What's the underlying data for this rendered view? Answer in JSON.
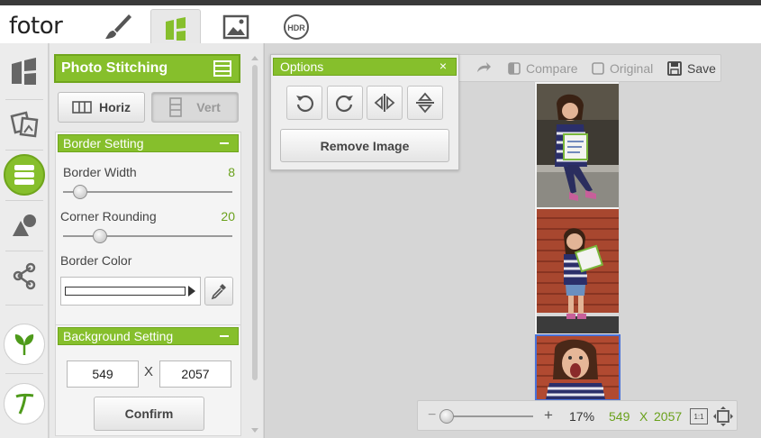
{
  "app": {
    "logo": "fotor"
  },
  "topbar": {
    "tools": [
      {
        "name": "edit",
        "icon": "brush-icon"
      },
      {
        "name": "collage",
        "icon": "collage-icon",
        "active": true
      },
      {
        "name": "design",
        "icon": "image-icon"
      },
      {
        "name": "hdr",
        "icon": "hdr-icon",
        "label": "HDR"
      }
    ]
  },
  "rail": {
    "items": [
      "template-icon",
      "freestyle-icon",
      "stitching-icon",
      "shapes-icon",
      "share-icon",
      "leaf-icon",
      "text-icon"
    ]
  },
  "panel": {
    "title": "Photo Stitching",
    "horiz_label": "Horiz",
    "vert_label": "Vert",
    "border": {
      "title": "Border Setting",
      "width_label": "Border Width",
      "width_value": "8",
      "width_fraction": 0.1,
      "rounding_label": "Corner Rounding",
      "rounding_value": "20",
      "rounding_fraction": 0.22,
      "color_label": "Border Color",
      "color_value": "#ffffff"
    },
    "background": {
      "title": "Background Setting",
      "width": "549",
      "x": "X",
      "height": "2057",
      "confirm_label": "Confirm"
    }
  },
  "toolbar": {
    "compare_label": "Compare",
    "original_label": "Original",
    "save_label": "Save"
  },
  "options": {
    "title": "Options",
    "close": "×",
    "remove_label": "Remove Image"
  },
  "zoom": {
    "minus": "−",
    "plus": "+",
    "percent": "17%",
    "fraction": 0.17,
    "width": "549",
    "x": "X",
    "height": "2057",
    "actual_label": "1:1"
  },
  "colors": {
    "accent": "#86bf2c",
    "value_green": "#6aa11c",
    "selection": "#4a72d8"
  }
}
